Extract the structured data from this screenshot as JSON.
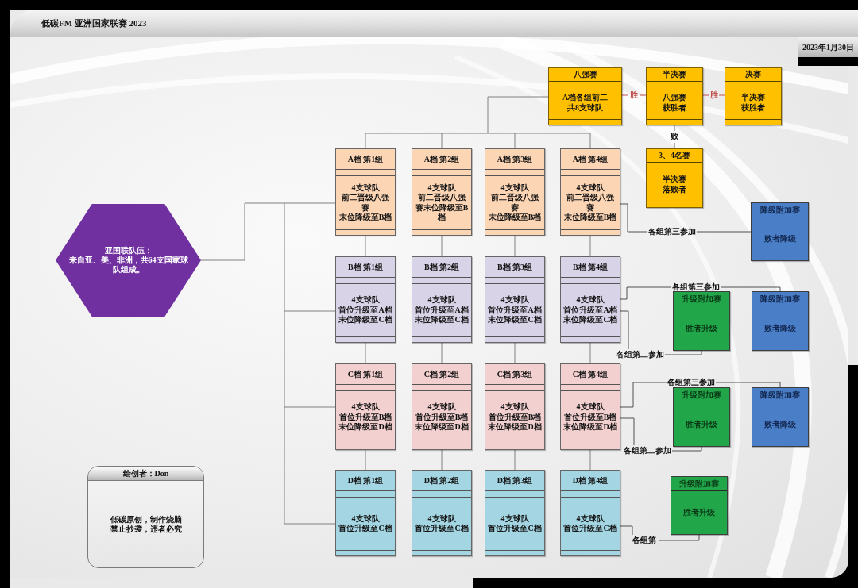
{
  "header": {
    "title": "低碳FM 亚洲国家联赛 2023",
    "date": "2023年1月30日"
  },
  "origin": {
    "lines": [
      "亚国联队伍：",
      "来自亚、美、非洲，共64支国家球队组成。"
    ]
  },
  "knockout": [
    {
      "title": "八强赛",
      "lines": [
        "A档各组前二",
        "共8支球队"
      ]
    },
    {
      "title": "半决赛",
      "lines": [
        "八强赛",
        "获胜者"
      ]
    },
    {
      "title": "决赛",
      "lines": [
        "半决赛",
        "获胜者"
      ]
    },
    {
      "title": "3、4名赛",
      "lines": [
        "半决赛",
        "落败者"
      ]
    }
  ],
  "knockout_links": [
    {
      "kind": "win",
      "label": "胜"
    },
    {
      "kind": "win",
      "label": "胜"
    },
    {
      "kind": "loss",
      "label": "败"
    }
  ],
  "tiers": [
    {
      "color": "#fcd5b4",
      "groups": [
        {
          "title": "A档 第1组",
          "lines": [
            "4支球队",
            "前二晋级八强赛",
            "末位降级至B档"
          ]
        },
        {
          "title": "A档 第2组",
          "lines": [
            "4支球队",
            "前二晋级八强赛末位降级至B档"
          ]
        },
        {
          "title": "A档 第3组",
          "lines": [
            "4支球队",
            "前二晋级八强赛",
            "末位降级至B档"
          ]
        },
        {
          "title": "A档 第4组",
          "lines": [
            "4支球队",
            "前二晋级八强赛",
            "末位降级至B档"
          ]
        }
      ]
    },
    {
      "color": "#d9d3e7",
      "groups": [
        {
          "title": "B档 第1组",
          "lines": [
            "4支球队",
            "首位升级至A档",
            "末位降级至C档"
          ]
        },
        {
          "title": "B档 第2组",
          "lines": [
            "4支球队",
            "首位升级至A档",
            "末位降级至C档"
          ]
        },
        {
          "title": "B档 第3组",
          "lines": [
            "4支球队",
            "首位升级至A档",
            "末位降级至C档"
          ]
        },
        {
          "title": "B档 第4组",
          "lines": [
            "4支球队",
            "首位升级至A档",
            "末位降级至C档"
          ]
        }
      ]
    },
    {
      "color": "#f2d0cf",
      "groups": [
        {
          "title": "C档 第1组",
          "lines": [
            "4支球队",
            "首位升级至B档",
            "末位降级至D档"
          ]
        },
        {
          "title": "C档 第2组",
          "lines": [
            "4支球队",
            "首位升级至B档",
            "末位降级至D档"
          ]
        },
        {
          "title": "C档 第3组",
          "lines": [
            "4支球队",
            "首位升级至B档",
            "末位降级至D档"
          ]
        },
        {
          "title": "C档 第4组",
          "lines": [
            "4支球队",
            "首位升级至B档",
            "末位降级至D档"
          ]
        }
      ]
    },
    {
      "color": "#a3d5e2",
      "groups": [
        {
          "title": "D档 第1组",
          "lines": [
            "4支球队",
            "首位升级至C档"
          ]
        },
        {
          "title": "D档 第2组",
          "lines": [
            "4支球队",
            "首位升级至C档"
          ]
        },
        {
          "title": "D档 第3组",
          "lines": [
            "4支球队",
            "首位升级至C档"
          ]
        },
        {
          "title": "D档 第4组",
          "lines": [
            "4支球队",
            "首位升级至C档"
          ]
        }
      ]
    }
  ],
  "playoffs": [
    {
      "kind": "relegation",
      "title": "降级附加赛",
      "body": "败者降级"
    },
    {
      "kind": "promotion",
      "title": "升级附加赛",
      "body": "胜者升级"
    },
    {
      "kind": "relegation",
      "title": "降级附加赛",
      "body": "败者降级"
    },
    {
      "kind": "promotion",
      "title": "升级附加赛",
      "body": "胜者升级"
    },
    {
      "kind": "relegation",
      "title": "降级附加赛",
      "body": "败者降级"
    },
    {
      "kind": "promotion",
      "title": "升级附加赛",
      "body": "胜者升级"
    }
  ],
  "playoff_links": [
    {
      "label": "各组第三参加"
    },
    {
      "label": "各组第三参加"
    },
    {
      "label": "各组第二参加"
    },
    {
      "label": "各组第三参加"
    },
    {
      "label": "各组第二参加"
    },
    {
      "label": "各组第"
    }
  ],
  "credit": {
    "title": "绘创者：Don",
    "lines": [
      "低碳原创，制作烧脑",
      "禁止抄袭，违者必究"
    ]
  }
}
